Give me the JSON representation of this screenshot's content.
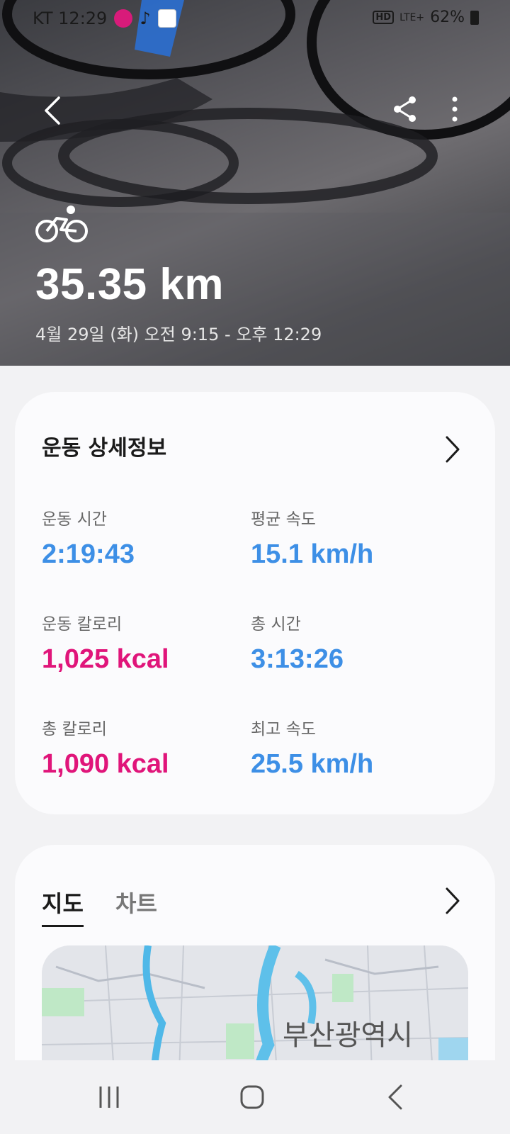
{
  "status_bar": {
    "carrier_time": "KT 12:29",
    "network": "LTE+",
    "battery": "62%",
    "hd_label": "HD"
  },
  "header": {
    "back_icon": "chevron-left-icon",
    "share_icon": "share-icon",
    "more_icon": "more-vertical-icon",
    "activity_icon": "cycling-icon",
    "distance": "35.35 km",
    "datetime": "4월 29일 (화) 오전 9:15 - 오후 12:29"
  },
  "details": {
    "title": "운동 상세정보",
    "stats": [
      {
        "label": "운동 시간",
        "value": "2:19:43",
        "color": "#3d8fe6"
      },
      {
        "label": "평균 속도",
        "value": "15.1 km/h",
        "color": "#3d8fe6"
      },
      {
        "label": "운동 칼로리",
        "value": "1,025 kcal",
        "color": "#e0157a"
      },
      {
        "label": "총 시간",
        "value": "3:13:26",
        "color": "#3d8fe6"
      },
      {
        "label": "총 칼로리",
        "value": "1,090 kcal",
        "color": "#e0157a"
      },
      {
        "label": "최고 속도",
        "value": "25.5 km/h",
        "color": "#3d8fe6"
      }
    ]
  },
  "map_section": {
    "tabs": [
      "지도",
      "차트"
    ],
    "active_tab": "지도",
    "map_label": "부산광역시",
    "route_color": "#1fb255"
  },
  "nav": {
    "recents_icon": "recents-icon",
    "home_icon": "home-icon",
    "back_icon": "back-icon"
  }
}
